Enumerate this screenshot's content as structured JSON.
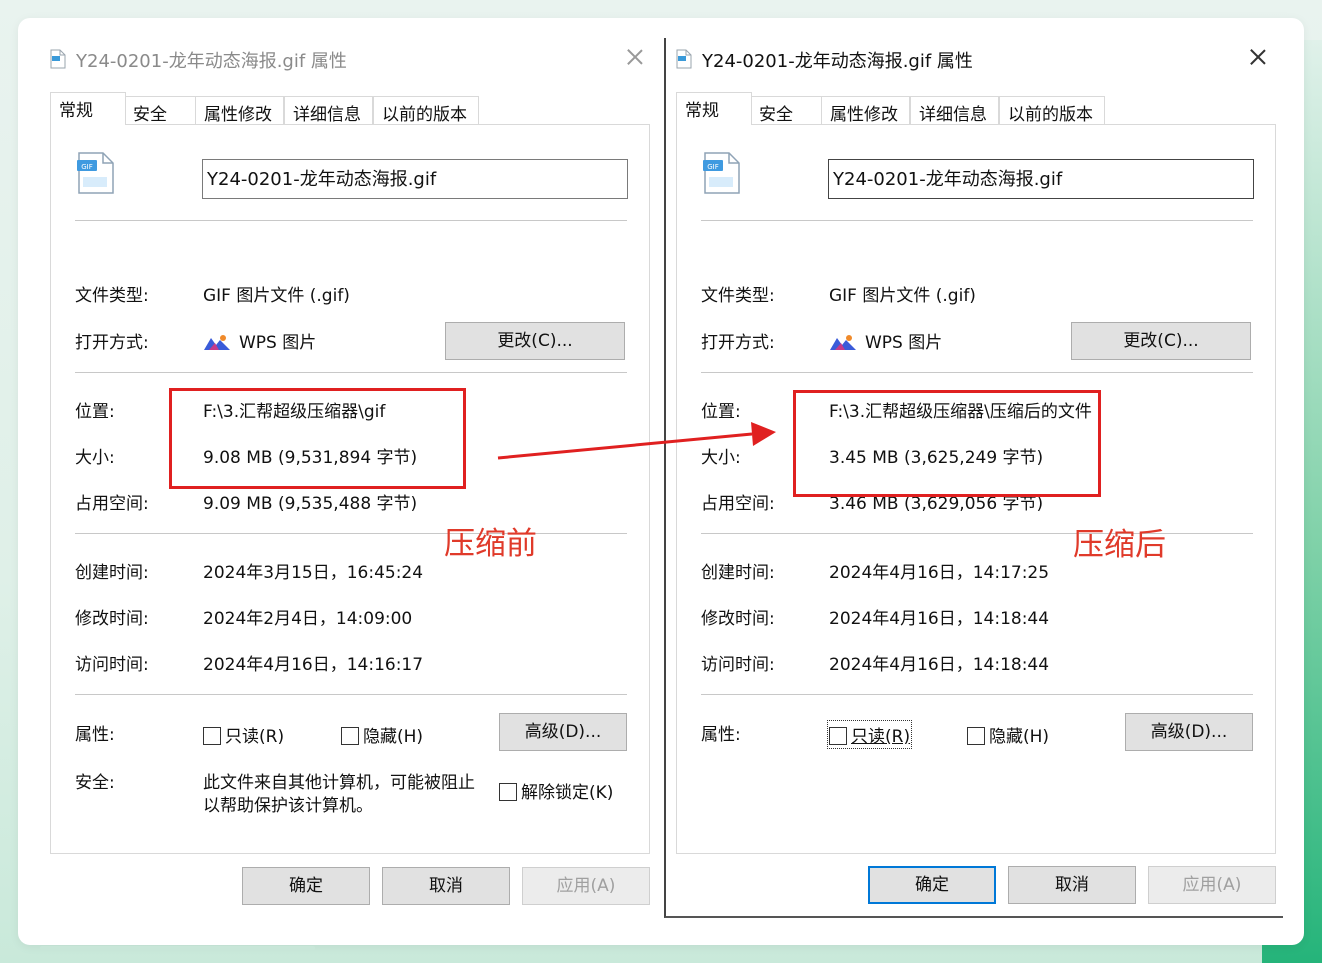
{
  "left_dialog": {
    "title": "Y24-0201-龙年动态海报.gif 属性",
    "tabs": [
      "常规",
      "安全",
      "属性修改",
      "详细信息",
      "以前的版本"
    ],
    "file_name": "Y24-0201-龙年动态海报.gif",
    "file_type_label": "文件类型:",
    "file_type_value": "GIF 图片文件 (.gif)",
    "open_with_label": "打开方式:",
    "open_with_value": "WPS 图片",
    "change_button": "更改(C)...",
    "location_label": "位置:",
    "location_value": "F:\\3.汇帮超级压缩器\\gif",
    "size_label": "大小:",
    "size_value": "9.08 MB (9,531,894 字节)",
    "disk_size_label": "占用空间:",
    "disk_size_value": "9.09 MB (9,535,488 字节)",
    "created_label": "创建时间:",
    "created_value": "2024年3月15日，16:45:24",
    "modified_label": "修改时间:",
    "modified_value": "2024年2月4日，14:09:00",
    "accessed_label": "访问时间:",
    "accessed_value": "2024年4月16日，14:16:17",
    "attributes_label": "属性:",
    "readonly_label": "只读(R)",
    "hidden_label": "隐藏(H)",
    "advanced_button": "高级(D)...",
    "security_label": "安全:",
    "security_text_line1": "此文件来自其他计算机，可能被阻止",
    "security_text_line2": "以帮助保护该计算机。",
    "unblock_label": "解除锁定(K)",
    "ok_button": "确定",
    "cancel_button": "取消",
    "apply_button": "应用(A)",
    "annotation": "压缩前"
  },
  "right_dialog": {
    "title": "Y24-0201-龙年动态海报.gif 属性",
    "tabs": [
      "常规",
      "安全",
      "属性修改",
      "详细信息",
      "以前的版本"
    ],
    "file_name": "Y24-0201-龙年动态海报.gif",
    "file_type_label": "文件类型:",
    "file_type_value": "GIF 图片文件 (.gif)",
    "open_with_label": "打开方式:",
    "open_with_value": "WPS 图片",
    "change_button": "更改(C)...",
    "location_label": "位置:",
    "location_value": "F:\\3.汇帮超级压缩器\\压缩后的文件",
    "size_label": "大小:",
    "size_value": "3.45 MB (3,625,249 字节)",
    "disk_size_label": "占用空间:",
    "disk_size_value": "3.46 MB (3,629,056 字节)",
    "created_label": "创建时间:",
    "created_value": "2024年4月16日，14:17:25",
    "modified_label": "修改时间:",
    "modified_value": "2024年4月16日，14:18:44",
    "accessed_label": "访问时间:",
    "accessed_value": "2024年4月16日，14:18:44",
    "attributes_label": "属性:",
    "readonly_label": "只读(R)",
    "hidden_label": "隐藏(H)",
    "advanced_button": "高级(D)...",
    "ok_button": "确定",
    "cancel_button": "取消",
    "apply_button": "应用(A)",
    "annotation": "压缩后"
  },
  "colors": {
    "annotation_red": "#e03a2a",
    "box_red": "#e02020",
    "focus_blue": "#0078d7",
    "wps_icon_blue": "#3a5bd9",
    "wps_icon_orange": "#f08a2a"
  }
}
